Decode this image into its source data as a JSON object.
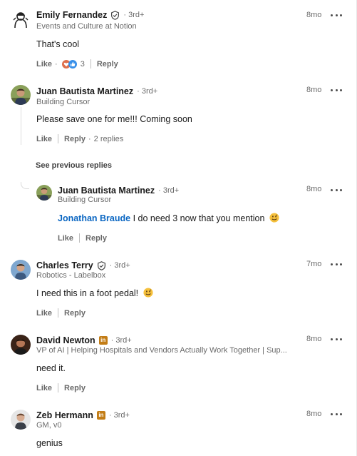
{
  "comments": [
    {
      "name": "Emily Fernandez",
      "degree": "3rd+",
      "headline": "Events and Culture at Notion",
      "time": "8mo",
      "text": "That's cool",
      "like_label": "Like",
      "reply_label": "Reply",
      "reaction_count": "3"
    },
    {
      "name": "Juan Bautista Martinez",
      "degree": "3rd+",
      "headline": "Building Cursor",
      "time": "8mo",
      "text": "Please save one for me!!! Coming soon",
      "like_label": "Like",
      "reply_label": "Reply",
      "replies_label": "2 replies",
      "see_previous": "See previous replies",
      "reply": {
        "name": "Juan Bautista Martinez",
        "degree": "3rd+",
        "headline": "Building Cursor",
        "time": "8mo",
        "mention": "Jonathan Braude",
        "text": "I do need 3 now that you mention",
        "like_label": "Like",
        "reply_label": "Reply"
      }
    },
    {
      "name": "Charles Terry",
      "degree": "3rd+",
      "headline": "Robotics - Labelbox",
      "time": "7mo",
      "text": "I need this in a foot pedal!",
      "like_label": "Like",
      "reply_label": "Reply"
    },
    {
      "name": "David Newton",
      "degree": "3rd+",
      "headline": "VP of AI | Helping Hospitals and Vendors Actually Work Together | Sup...",
      "time": "8mo",
      "text": "need it.",
      "like_label": "Like",
      "reply_label": "Reply"
    },
    {
      "name": "Zeb Hermann",
      "degree": "3rd+",
      "headline": "GM, v0",
      "time": "8mo",
      "text": "genius"
    }
  ],
  "colors": {
    "link": "#0a66c2",
    "linkedin_badge": "#c37d16",
    "muted": "#666666"
  },
  "icons": {
    "verified": "shield-check-icon",
    "more": "ellipsis-icon",
    "badge": "linkedin-premium-icon",
    "love": "heart-reaction-icon",
    "like": "thumbs-up-reaction-icon",
    "emoji": "grimacing-emoji-icon"
  }
}
